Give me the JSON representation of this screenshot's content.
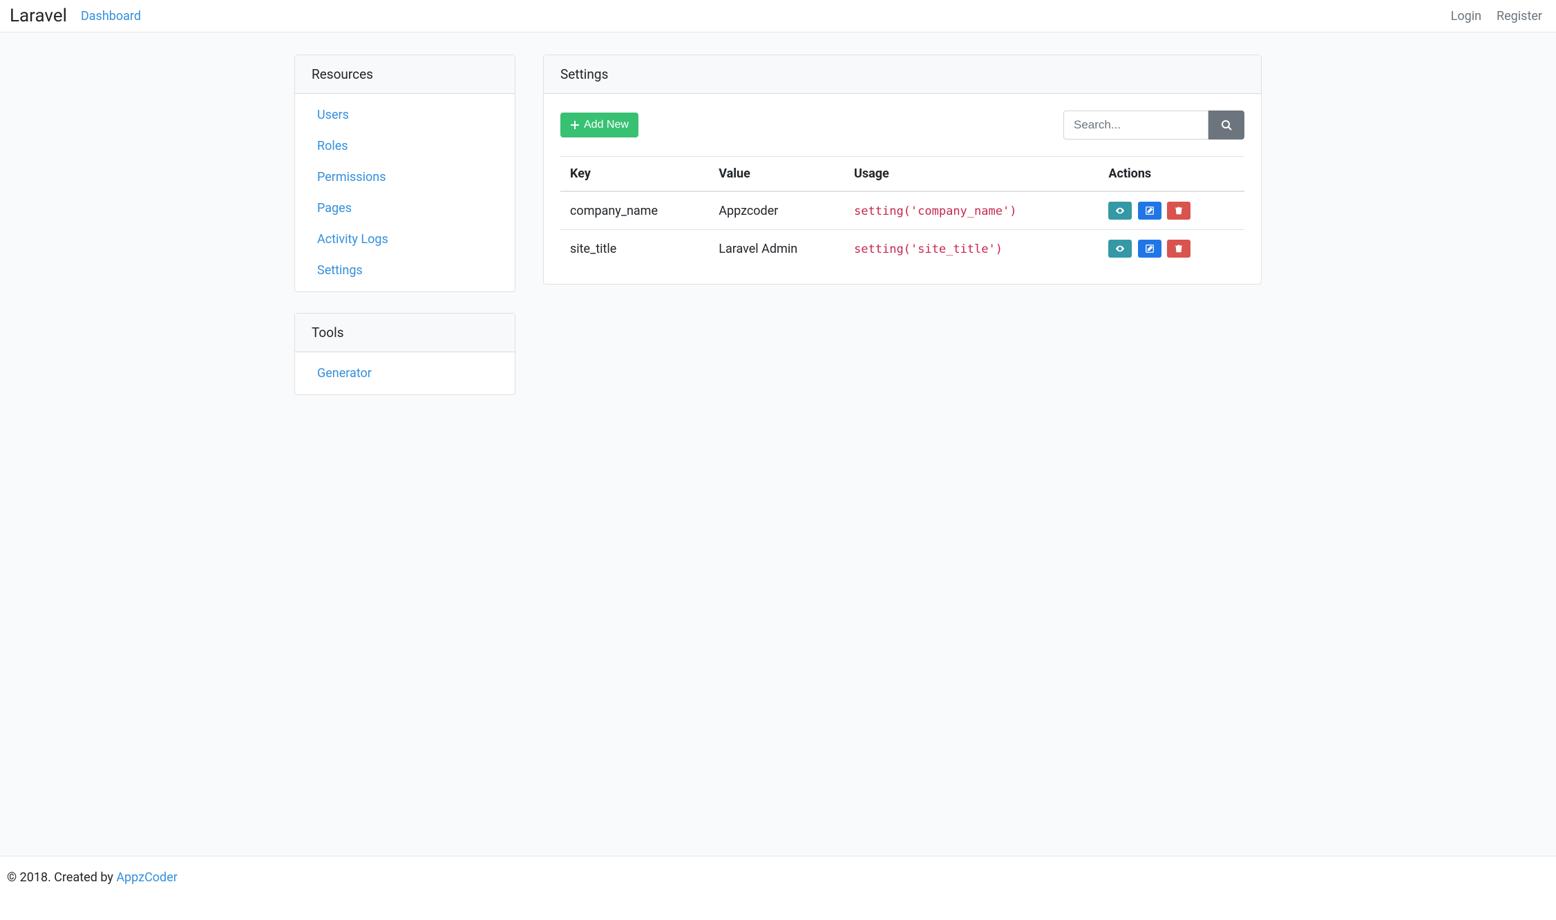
{
  "navbar": {
    "brand": "Laravel",
    "left_link": "Dashboard",
    "login": "Login",
    "register": "Register"
  },
  "sidebar": {
    "resources_title": "Resources",
    "resources": [
      "Users",
      "Roles",
      "Permissions",
      "Pages",
      "Activity Logs",
      "Settings"
    ],
    "tools_title": "Tools",
    "tools": [
      "Generator"
    ]
  },
  "main": {
    "title": "Settings",
    "add_new": "Add New",
    "search_placeholder": "Search..."
  },
  "table": {
    "headers": [
      "Key",
      "Value",
      "Usage",
      "Actions"
    ],
    "rows": [
      {
        "key": "company_name",
        "value": "Appzcoder",
        "usage": "setting('company_name')"
      },
      {
        "key": "site_title",
        "value": "Laravel Admin",
        "usage": "setting('site_title')"
      }
    ]
  },
  "footer": {
    "prefix": "© 2018. Created by ",
    "link_text": "AppzCoder"
  }
}
